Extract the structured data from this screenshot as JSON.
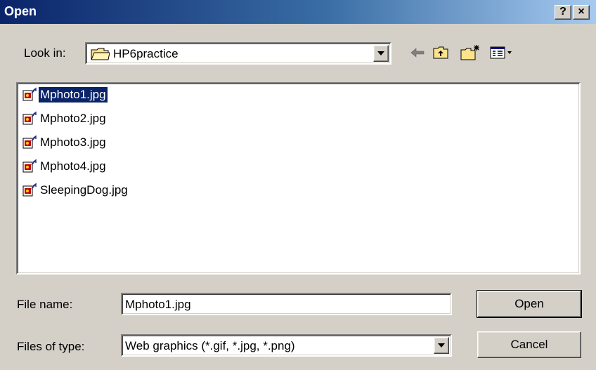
{
  "window": {
    "title": "Open",
    "help_label": "?",
    "close_label": "×"
  },
  "look_in": {
    "label": "Look in:",
    "value": "HP6practice",
    "icon": "folder-icon"
  },
  "toolbar": {
    "back_icon": "back-arrow-icon",
    "up_icon": "up-folder-icon",
    "new_folder_icon": "new-folder-icon",
    "view_menu_icon": "view-menu-icon"
  },
  "files": [
    {
      "name": "Mphoto1.jpg",
      "selected": true
    },
    {
      "name": "Mphoto2.jpg",
      "selected": false
    },
    {
      "name": "Mphoto3.jpg",
      "selected": false
    },
    {
      "name": "Mphoto4.jpg",
      "selected": false
    },
    {
      "name": "SleepingDog.jpg",
      "selected": false
    }
  ],
  "file_name": {
    "label": "File name:",
    "value": "Mphoto1.jpg"
  },
  "file_type": {
    "label": "Files of type:",
    "value": "Web graphics (*.gif, *.jpg, *.png)"
  },
  "buttons": {
    "open_label": "Open",
    "cancel_label": "Cancel"
  },
  "colors": {
    "title_bar": "#0a246a",
    "dialog_face": "#d4d0c8",
    "selection": "#0a246a"
  }
}
